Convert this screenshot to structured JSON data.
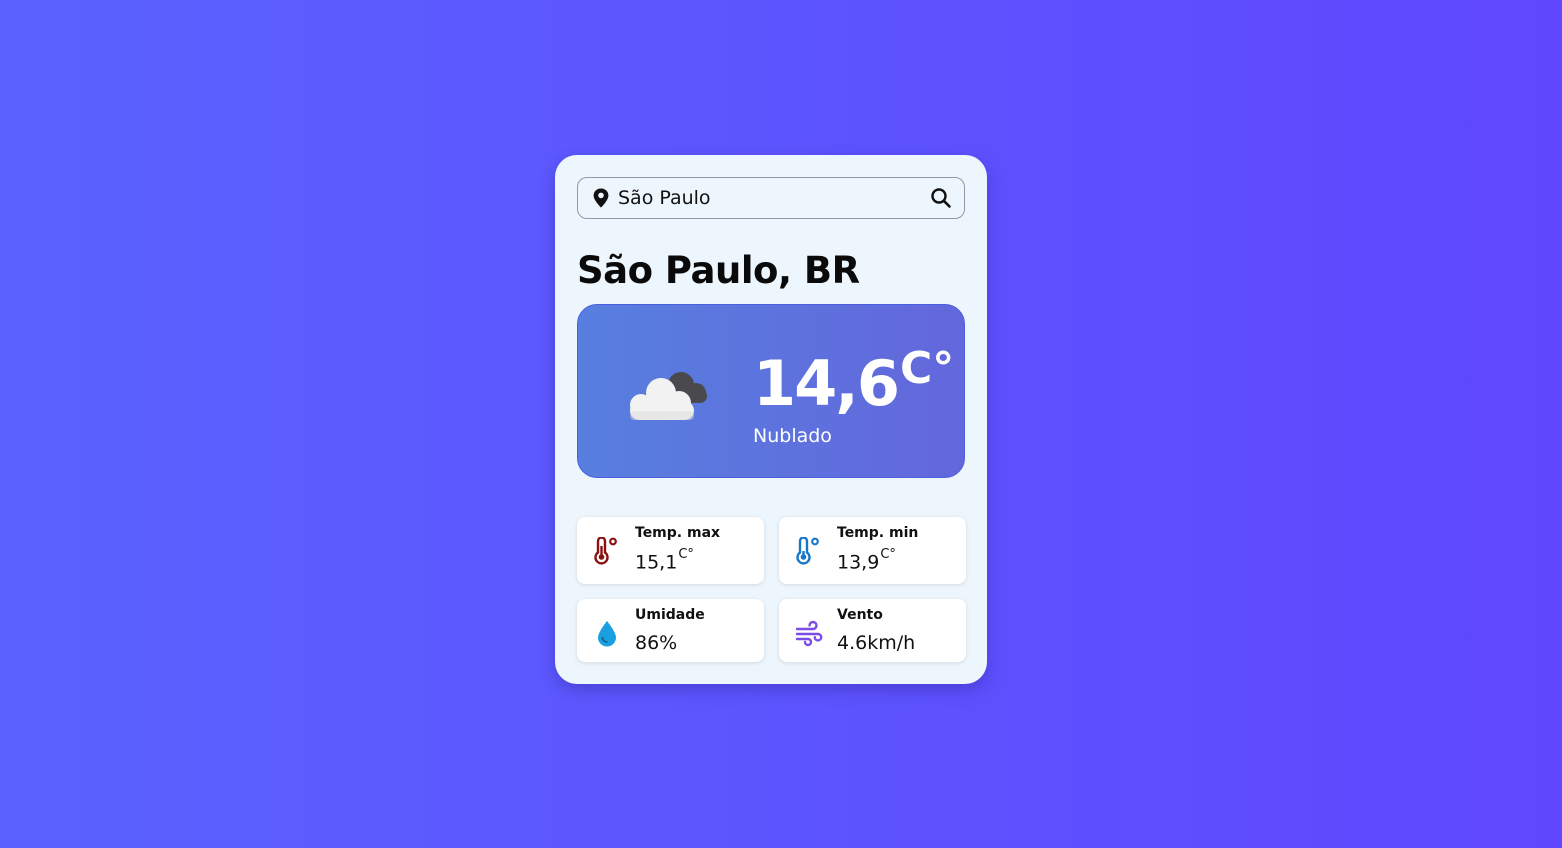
{
  "search": {
    "value": "São Paulo",
    "icon": "map-pin-icon",
    "button_icon": "search-icon"
  },
  "location": {
    "title": "São Paulo, BR"
  },
  "current": {
    "temperature": "14,6",
    "unit": "C°",
    "description": "Nublado",
    "icon": "cloudy-icon"
  },
  "stats": {
    "max": {
      "label": "Temp. max",
      "value": "15,1",
      "unit": "C°",
      "icon": "thermometer-hot-icon",
      "color": "#8b1010"
    },
    "min": {
      "label": "Temp. min",
      "value": "13,9",
      "unit": "C°",
      "icon": "thermometer-cold-icon",
      "color": "#1877c9"
    },
    "humidity": {
      "label": "Umidade",
      "value": "86%",
      "icon": "water-drop-icon",
      "color": "#1a9fe0"
    },
    "wind": {
      "label": "Vento",
      "value": "4.6km/h",
      "icon": "wind-icon",
      "color": "#7b4de8"
    }
  },
  "colors": {
    "background_start": "#5a62fe",
    "background_end": "#5f47fe",
    "card": "#eef6fd",
    "weather_box": "#5a77de"
  }
}
